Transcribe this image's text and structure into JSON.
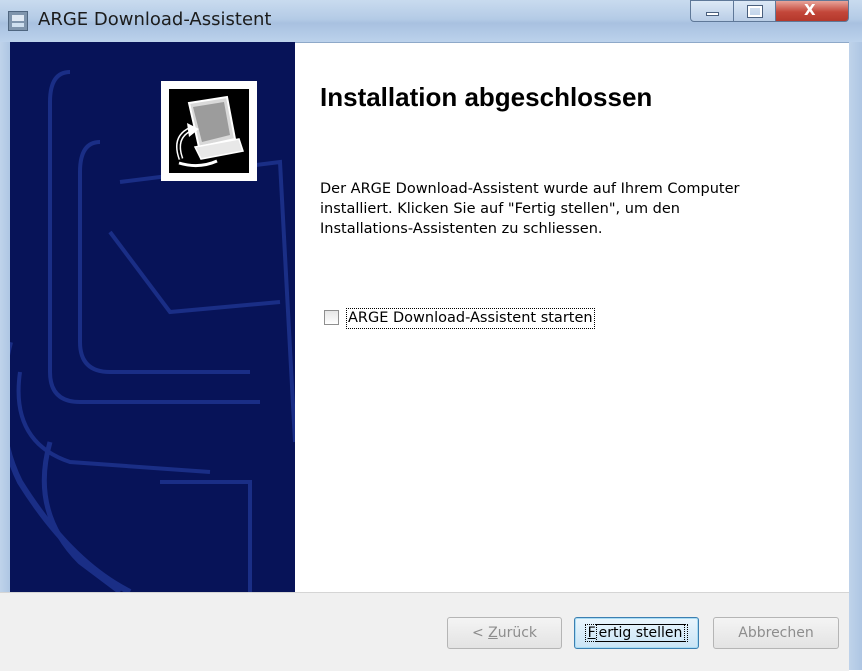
{
  "window": {
    "title": "ARGE Download-Assistent",
    "buttons": {
      "close_glyph": "X"
    }
  },
  "content": {
    "heading": "Installation abgeschlossen",
    "description_lines": [
      "Der ARGE Download-Assistent wurde auf Ihrem Computer",
      "installiert. Klicken Sie auf \"Fertig stellen\", um den",
      "Installations-Assistenten zu schliessen."
    ],
    "checkbox": {
      "label": "ARGE Download-Assistent starten",
      "checked": false
    }
  },
  "footer": {
    "back_label_prefix": "< ",
    "back_label_mnemonic": "Z",
    "back_label_rest": "urück",
    "finish_label_mnemonic": "F",
    "finish_label_rest": "ertig stellen",
    "cancel_label": "Abbrechen"
  },
  "colors": {
    "banner": "#071358",
    "banner_shapes": "#1a2e86",
    "default_button_border": "#3c7fb1"
  },
  "icons": {
    "app": "installer-app-icon",
    "logo": "computer-install-icon"
  }
}
